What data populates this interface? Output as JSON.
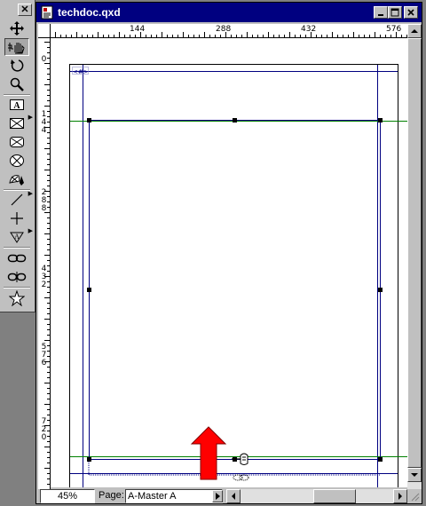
{
  "document": {
    "title": "techdoc.qxd"
  },
  "palette": {
    "close_glyph": "✕",
    "tools": [
      "item-tool",
      "content-tool",
      "rotation-tool",
      "zoom-tool",
      "text-box-tool",
      "rectangle-picture-box-tool",
      "rounded-picture-box-tool",
      "oval-picture-box-tool",
      "bezier-picture-box-tool",
      "line-tool",
      "orthogonal-line-tool",
      "text-path-tool",
      "linking-tool",
      "unlinking-tool",
      "star-tool"
    ]
  },
  "rulers": {
    "horizontal_labels": [
      "144",
      "288",
      "432",
      "576"
    ],
    "vertical_labels": [
      {
        "digits": "0"
      },
      {
        "digits": "144"
      },
      {
        "digits": "288"
      },
      {
        "digits": "432"
      },
      {
        "digits": "576"
      },
      {
        "digits": "720"
      }
    ]
  },
  "canvas": {
    "page_number_marker": "<#>",
    "annotation": "red-up-arrow",
    "guide_color": "#008000",
    "margin_color": "#000080",
    "arrow_color": "#ff0000"
  },
  "status_bar": {
    "zoom": "45%",
    "page_label": "Page:",
    "page_value": "A-Master A"
  },
  "colors": {
    "title_bar": "#000080",
    "chrome": "#c0c0c0",
    "workspace": "#808080"
  }
}
